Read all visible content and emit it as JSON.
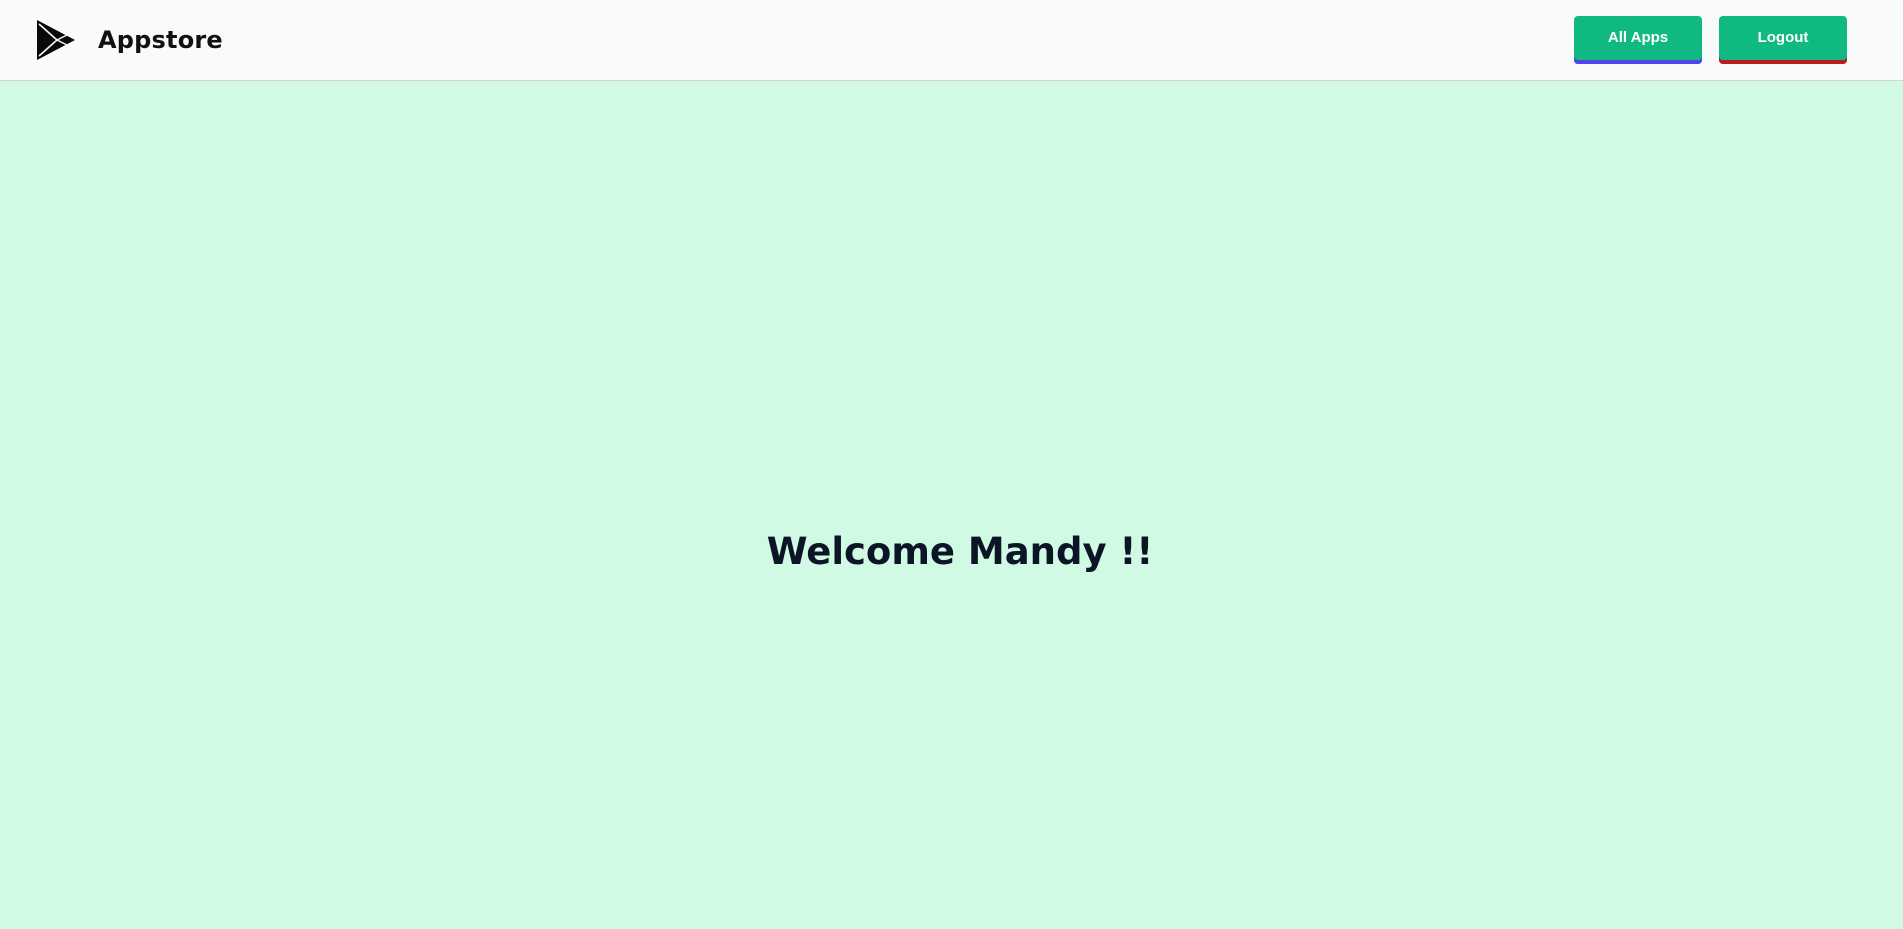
{
  "navbar": {
    "brand_name": "Appstore",
    "logo_icon": "play-store-icon",
    "actions": {
      "all_apps_label": "All Apps",
      "logout_label": "Logout"
    }
  },
  "main": {
    "welcome_text": "Welcome Mandy !!"
  },
  "colors": {
    "page_background": "#d1fae5",
    "navbar_background": "#f8fafc",
    "button_green": "#10b981",
    "all_apps_underline": "#4f46e5",
    "logout_underline": "#b91c1c"
  }
}
